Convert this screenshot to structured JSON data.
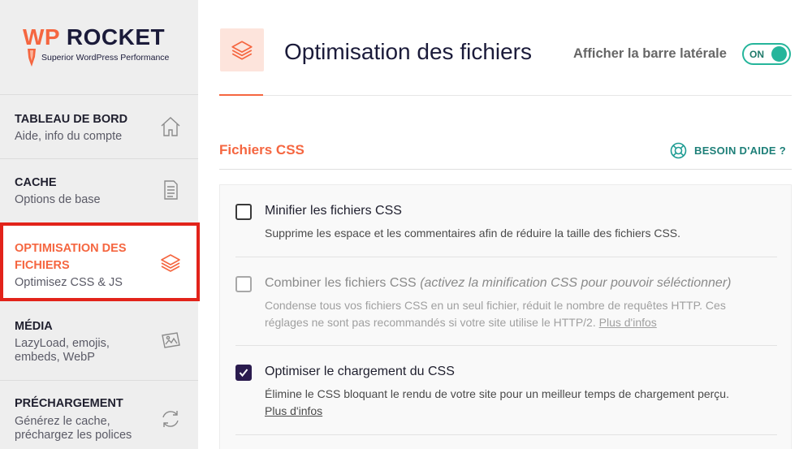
{
  "brand": {
    "wp": "WP",
    "rocket": "ROCKET",
    "tagline": "Superior WordPress Performance",
    "accent": "#f56640",
    "navy": "#1b1b3a"
  },
  "sidebar": {
    "items": [
      {
        "title": "TABLEAU DE BORD",
        "sub": "Aide, info du compte",
        "icon": "home-icon"
      },
      {
        "title": "CACHE",
        "sub": "Options de base",
        "icon": "document-icon"
      },
      {
        "title_line1": "OPTIMISATION DES",
        "title_line2": "FICHIERS",
        "sub": "Optimisez CSS & JS",
        "icon": "layers-icon",
        "active": true
      },
      {
        "title": "MÉDIA",
        "sub_line1": "LazyLoad, emojis,",
        "sub_line2": "embeds, WebP",
        "icon": "images-icon"
      },
      {
        "title": "PRÉCHARGEMENT",
        "sub_line1": "Générez le cache,",
        "sub_line2": "préchargez les polices",
        "icon": "refresh-icon"
      }
    ]
  },
  "header": {
    "title": "Optimisation des fichiers",
    "sidebar_toggle_label": "Afficher la barre latérale",
    "toggle_state": "ON"
  },
  "section": {
    "title": "Fichiers CSS",
    "help_label": "BESOIN D'AIDE ?"
  },
  "options": [
    {
      "label": "Minifier les fichiers CSS",
      "desc": "Supprime les espace et les commentaires afin de réduire la taille des fichiers CSS.",
      "checked": false,
      "disabled": false
    },
    {
      "label": "Combiner les fichiers CSS",
      "label_note": "(activez la minification CSS pour pouvoir séléctionner)",
      "desc_line1": "Condense tous vos fichiers CSS en un seul fichier, réduit le nombre de requêtes HTTP. Ces",
      "desc_line2": "réglages ne sont pas recommandés si votre site utilise le HTTP/2.",
      "more_link": "Plus d'infos",
      "checked": false,
      "disabled": true
    },
    {
      "label": "Optimiser le chargement du CSS",
      "desc": "Élimine le CSS bloquant le rendu de votre site pour un meilleur temps de chargement perçu.",
      "more_link": "Plus d'infos",
      "checked": true,
      "disabled": false
    }
  ]
}
